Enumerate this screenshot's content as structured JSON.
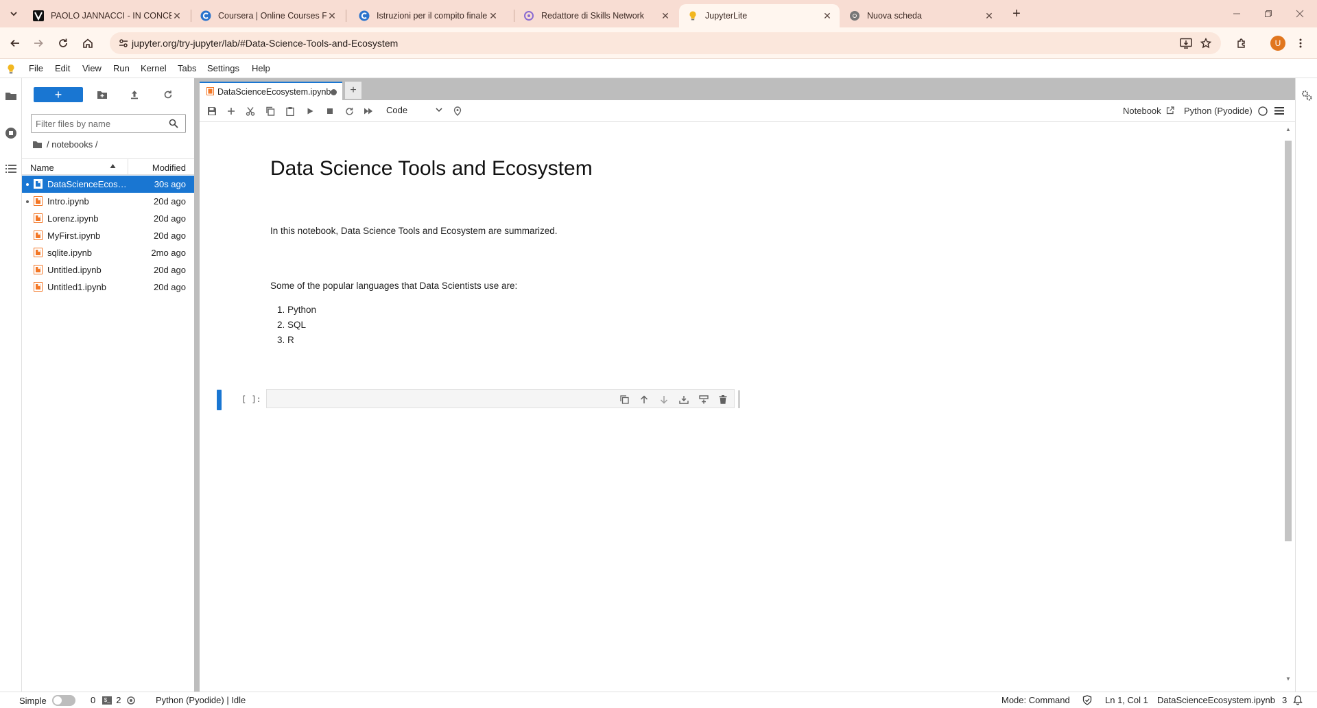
{
  "browser": {
    "tabs": [
      {
        "title": "PAOLO JANNACCI - IN CONCERT",
        "icon": "v-logo-icon",
        "active": false
      },
      {
        "title": "Coursera | Online Courses From",
        "icon": "coursera-icon",
        "active": false
      },
      {
        "title": "Istruzioni per il compito finale:",
        "icon": "coursera-icon",
        "active": false
      },
      {
        "title": "Redattore di Skills Network",
        "icon": "skills-network-icon",
        "active": false
      },
      {
        "title": "JupyterLite",
        "icon": "jupyter-bulb-icon",
        "active": true
      },
      {
        "title": "Nuova scheda",
        "icon": "chrome-icon",
        "active": false
      }
    ],
    "new_tab": "+",
    "url": "jupyter.org/try-jupyter/lab/#Data-Science-Tools-and-Ecosystem",
    "profile_initial": "U",
    "accent": "#f8ddd3"
  },
  "menubar": {
    "items": [
      "File",
      "Edit",
      "View",
      "Run",
      "Kernel",
      "Tabs",
      "Settings",
      "Help"
    ]
  },
  "filebrowser": {
    "new_button": "+",
    "filter_placeholder": "Filter files by name",
    "breadcrumb": "/ notebooks /",
    "col_name": "Name",
    "col_modified": "Modified",
    "files": [
      {
        "name": "DataScienceEcosy...",
        "modified": "30s ago",
        "selected": true,
        "running": true
      },
      {
        "name": "Intro.ipynb",
        "modified": "20d ago",
        "selected": false,
        "running": true
      },
      {
        "name": "Lorenz.ipynb",
        "modified": "20d ago",
        "selected": false,
        "running": false
      },
      {
        "name": "MyFirst.ipynb",
        "modified": "20d ago",
        "selected": false,
        "running": false
      },
      {
        "name": "sqlite.ipynb",
        "modified": "2mo ago",
        "selected": false,
        "running": false
      },
      {
        "name": "Untitled.ipynb",
        "modified": "20d ago",
        "selected": false,
        "running": false
      },
      {
        "name": "Untitled1.ipynb",
        "modified": "20d ago",
        "selected": false,
        "running": false
      }
    ]
  },
  "notebook": {
    "tab_title": "DataScienceEcosystem.ipynb",
    "cell_type": "Code",
    "toolbar_notebook": "Notebook",
    "kernel": "Python (Pyodide)",
    "heading": "Data Science Tools and Ecosystem",
    "intro": "In this notebook, Data Science Tools and Ecosystem are summarized.",
    "languages_intro": "Some of the popular languages that Data Scientists use are:",
    "languages": [
      "Python",
      "SQL",
      "R"
    ],
    "prompt": "[ ]:"
  },
  "statusbar": {
    "mode_label": "Simple",
    "terminals": "0",
    "kernels": "2",
    "kernel_status": "Python (Pyodide) | Idle",
    "mode": "Mode: Command",
    "position": "Ln 1, Col 1",
    "filename": "DataScienceEcosystem.ipynb",
    "notifications": "3"
  }
}
